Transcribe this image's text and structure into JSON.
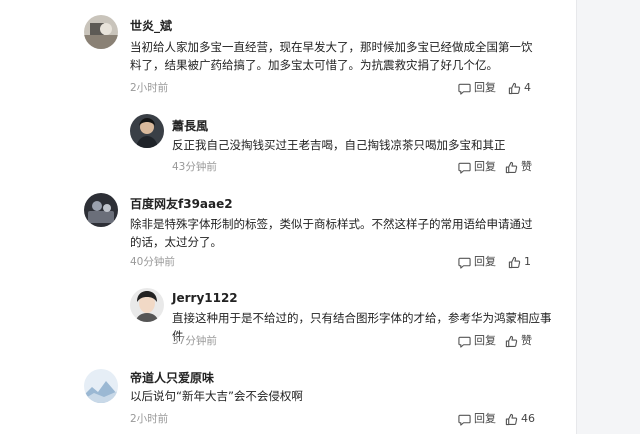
{
  "comments": [
    {
      "username": "世炎_斌",
      "text": "当初给人家加多宝一直经营，现在早发大了，那时候加多宝已经做成全国第一饮料了，结果被广药给搞了。加多宝太可惜了。为抗震救灾捐了好几个亿。",
      "time": "2小时前",
      "reply_label": "回复",
      "like_label": "4"
    },
    {
      "username": "蕭長風",
      "text": "反正我自己没掏钱买过王老吉喝，自己掏钱凉茶只喝加多宝和其正",
      "time": "43分钟前",
      "reply_label": "回复",
      "like_label": "赞"
    },
    {
      "username": "百度网友f39aae2",
      "text": "除非是特殊字体形制的标签，类似于商标样式。不然这样子的常用语给申请通过的话，太过分了。",
      "time": "40分钟前",
      "reply_label": "回复",
      "like_label": "1"
    },
    {
      "username": "Jerry1122",
      "text": "直接这种用于是不给过的，只有结合图形字体的才给，参考华为鸿蒙相应事件",
      "time": "37分钟前",
      "reply_label": "回复",
      "like_label": "赞"
    },
    {
      "username": "帝道人只爱原味",
      "text": "以后说句“新年大吉”会不会侵权啊",
      "time": "2小时前",
      "reply_label": "回复",
      "like_label": "46"
    }
  ],
  "icons": {
    "reply": "comment-bubble-icon",
    "like": "thumbs-up-icon"
  },
  "colors": {
    "username": "#222222",
    "text": "#222222",
    "time": "#999999",
    "action": "#444444",
    "side_strip": "#f4f5f7"
  }
}
